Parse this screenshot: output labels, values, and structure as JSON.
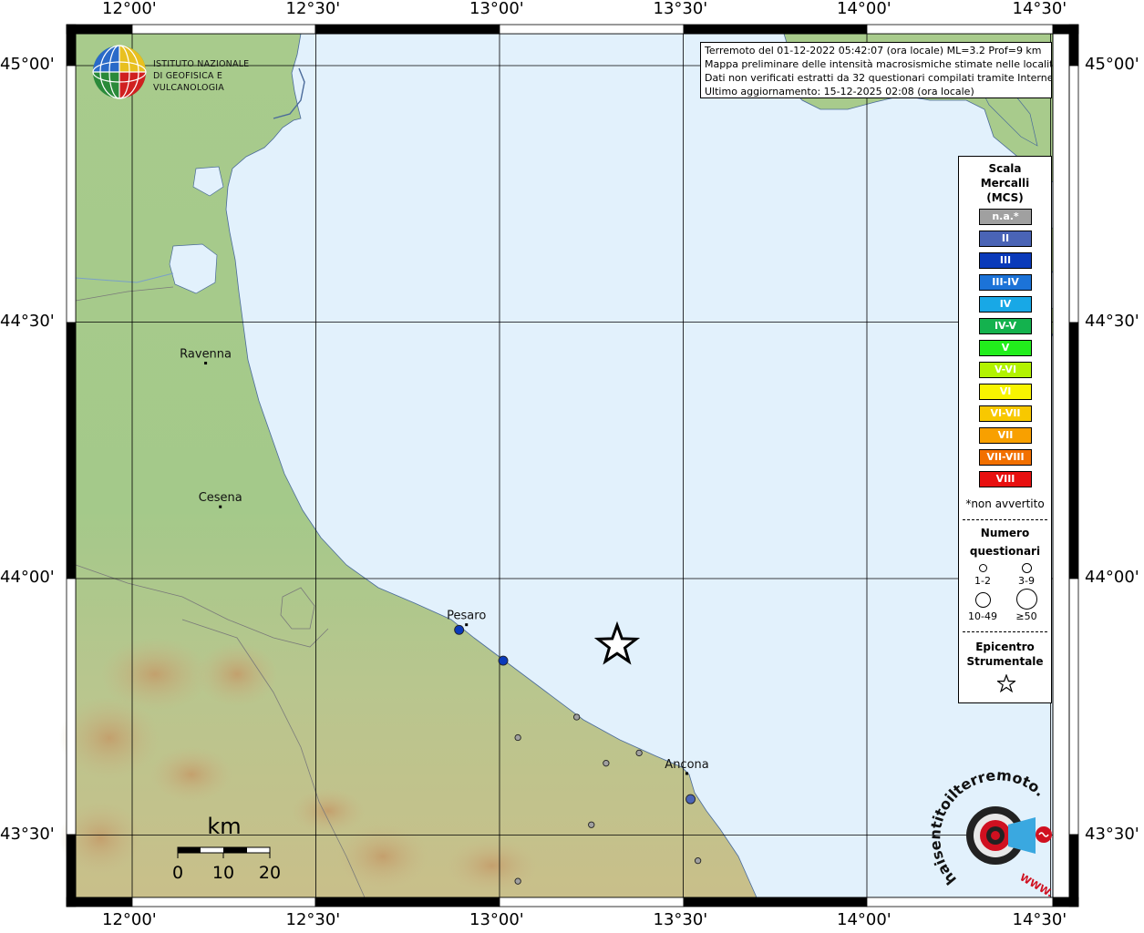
{
  "info": {
    "line1": "Terremoto del 01-12-2022 05:42:07 (ora locale) ML=3.2 Prof=9 km",
    "line2": "Mappa preliminare delle intensità macrosismiche stimate nelle località",
    "line3": "Dati non verificati estratti da 32 questionari compilati tramite Internet.",
    "line4": "Ultimo aggiornamento: 15-12-2025 02:08 (ora locale)"
  },
  "axes": {
    "lon_labels": [
      "12°00'",
      "12°30'",
      "13°00'",
      "13°30'",
      "14°00'",
      "14°30'"
    ],
    "lat_labels": [
      "45°00'",
      "44°30'",
      "44°00'",
      "43°30'"
    ]
  },
  "cities": [
    {
      "name": "Ravenna",
      "lon": 12.2,
      "lat": 44.42
    },
    {
      "name": "Cesena",
      "lon": 12.24,
      "lat": 44.14
    },
    {
      "name": "Pesaro",
      "lon": 12.91,
      "lat": 43.91
    },
    {
      "name": "Ancona",
      "lon": 13.51,
      "lat": 43.62
    }
  ],
  "epicenter": {
    "lon": 13.32,
    "lat": 43.87
  },
  "observations": [
    {
      "lon": 12.89,
      "lat": 43.9,
      "intensity": "III",
      "count": "3-9"
    },
    {
      "lon": 13.01,
      "lat": 43.84,
      "intensity": "III",
      "count": "3-9"
    },
    {
      "lon": 13.52,
      "lat": 43.57,
      "intensity": "II",
      "count": "3-9"
    },
    {
      "lon": 13.21,
      "lat": 43.73,
      "intensity": "n.a.*",
      "count": "1-2"
    },
    {
      "lon": 13.05,
      "lat": 43.69,
      "intensity": "n.a.*",
      "count": "1-2"
    },
    {
      "lon": 13.29,
      "lat": 43.64,
      "intensity": "n.a.*",
      "count": "1-2"
    },
    {
      "lon": 13.38,
      "lat": 43.66,
      "intensity": "n.a.*",
      "count": "1-2"
    },
    {
      "lon": 13.25,
      "lat": 43.52,
      "intensity": "n.a.*",
      "count": "1-2"
    },
    {
      "lon": 13.54,
      "lat": 43.45,
      "intensity": "n.a.*",
      "count": "1-2"
    },
    {
      "lon": 13.05,
      "lat": 43.41,
      "intensity": "n.a.*",
      "count": "1-2"
    }
  ],
  "legend": {
    "title": [
      "Scala",
      "Mercalli",
      "(MCS)"
    ],
    "scale": [
      {
        "label": "n.a.*",
        "color": "#a0a0a0"
      },
      {
        "label": "II",
        "color": "#4a64b6"
      },
      {
        "label": "III",
        "color": "#0a3aba"
      },
      {
        "label": "III-IV",
        "color": "#1c73d8"
      },
      {
        "label": "IV",
        "color": "#18a8e6"
      },
      {
        "label": "IV-V",
        "color": "#14b24e"
      },
      {
        "label": "V",
        "color": "#22ee1c"
      },
      {
        "label": "V-VI",
        "color": "#b2f200"
      },
      {
        "label": "VI",
        "color": "#f8f400"
      },
      {
        "label": "VI-VII",
        "color": "#f8c800"
      },
      {
        "label": "VII",
        "color": "#f8a000"
      },
      {
        "label": "VII-VIII",
        "color": "#f27000"
      },
      {
        "label": "VIII",
        "color": "#e81010"
      }
    ],
    "footnote": "*non avvertito",
    "count_title": [
      "Numero",
      "questionari"
    ],
    "count_classes": [
      "1-2",
      "3-9",
      "10-49",
      "≥50"
    ],
    "epicenter_title": [
      "Epicentro",
      "Strumentale"
    ]
  },
  "scalebar": {
    "unit": "km",
    "ticks": [
      "0",
      "10",
      "20"
    ]
  },
  "logos": {
    "ingv_line1": "ISTITUTO NAZIONALE",
    "ingv_line2": "DI GEOFISICA E VULCANOLOGIA",
    "hsit": "haisentitoilterremoto.it",
    "hsit_www": "WWW."
  },
  "colors": {
    "sea": "#e2f1fc",
    "land": "#a3c888",
    "frame": "#000000"
  }
}
